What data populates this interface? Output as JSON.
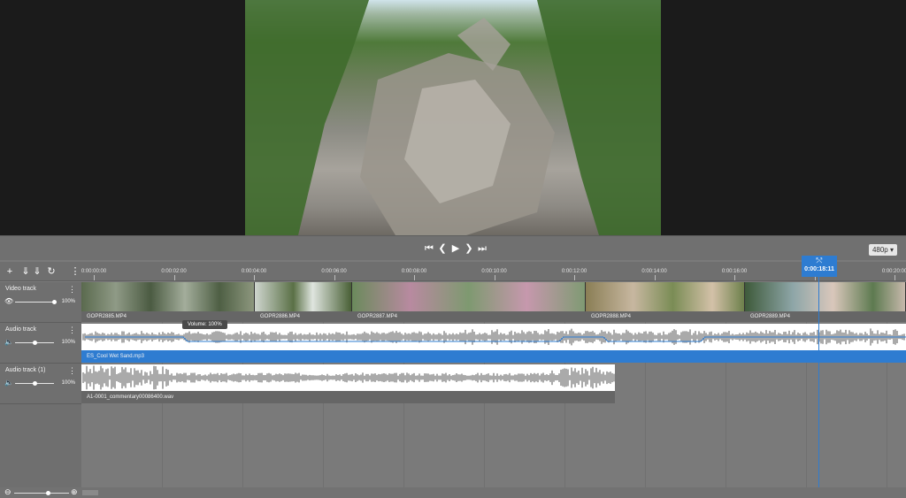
{
  "transport": {
    "to_start": "⏮",
    "prev_frame": "❮",
    "play": "▶",
    "next_frame": "❯",
    "to_end": "⏭",
    "quality": "480p ▾"
  },
  "tools": {
    "add": "+",
    "import_1": "⇓",
    "import_2": "⇓",
    "refresh": "↻",
    "menu": "⋮"
  },
  "ruler": {
    "ticks": [
      "0:00:00:00",
      "0:00:02:00",
      "0:00:04:00",
      "0:00:06:00",
      "0:00:08:00",
      "0:00:10:00",
      "0:00:12:00",
      "0:00:14:00",
      "0:00:16:00",
      "0:00:18:00",
      "0:00:20:00"
    ]
  },
  "playhead": {
    "icon": "⤲",
    "time": "0:00:18:11"
  },
  "tracks": [
    {
      "name": "Video track",
      "icon": "eye-icon",
      "value": "100%",
      "level": 1.0
    },
    {
      "name": "Audio track",
      "icon": "speaker-icon",
      "value": "100%",
      "level": 0.5
    },
    {
      "name": "Audio track (1)",
      "icon": "speaker-icon",
      "value": "100%",
      "level": 0.5
    }
  ],
  "video_clips": [
    "GOPR2885.MP4",
    "GOPR2886.MP4",
    "GOPR2887.MP4",
    "GOPR2888.MP4",
    "GOPR2889.MP4"
  ],
  "audio_clips": {
    "track1": "ES_Cool Wet Sand.mp3",
    "track2": "A1-0001_commentary00086400.wav"
  },
  "tooltip": "Volume: 100%",
  "colors": {
    "accent": "#2e7cd1",
    "panel": "#7a7a7a"
  }
}
